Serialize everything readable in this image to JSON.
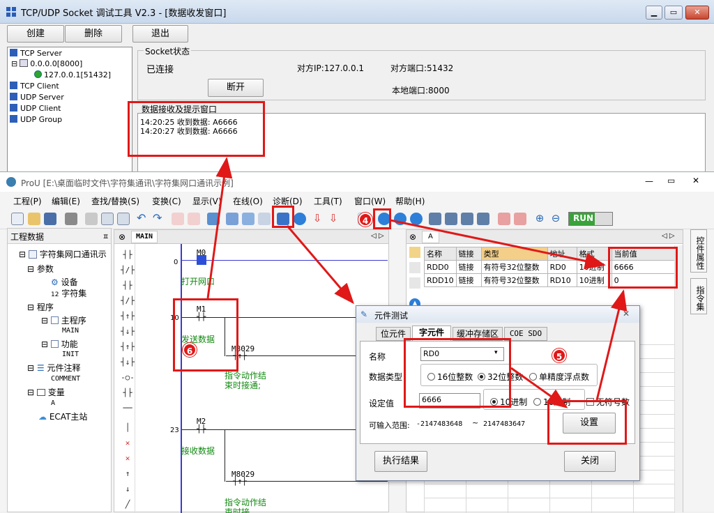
{
  "win1": {
    "title": "TCP/UDP Socket 调试工具 V2.3  - [数据收发窗口]",
    "buttons": {
      "create": "创建",
      "delete": "删除",
      "exit": "退出"
    },
    "tree": {
      "tcp_server": "TCP Server",
      "server_addr": "0.0.0.0[8000]",
      "client_conn": "127.0.0.1[51432]",
      "tcp_client": "TCP Client",
      "udp_server": "UDP Server",
      "udp_client": "UDP Client",
      "udp_group": "UDP Group"
    },
    "socket_status": {
      "group_title": "Socket状态",
      "state": "已连接",
      "peer_ip": "对方IP:127.0.0.1",
      "peer_port": "对方端口:51432",
      "local_port": "本地端口:8000",
      "disconnect": "断开"
    },
    "receive": {
      "group_title": "数据接收及提示窗口",
      "lines": [
        "14:20:25 收到数据: A6666",
        "14:20:27 收到数据: A6666"
      ]
    }
  },
  "win2": {
    "title": "ProU [E:\\桌面临时文件\\字符集通讯\\字符集网口通讯示例]",
    "menu": [
      "工程(P)",
      "编辑(E)",
      "查找/替换(S)",
      "变换(C)",
      "显示(V)",
      "在线(O)",
      "诊断(D)",
      "工具(T)",
      "窗口(W)",
      "帮助(H)"
    ],
    "run_label": "RUN",
    "project_panel": {
      "header": "工程数据",
      "root": "字符集网口通讯示",
      "params": "参数",
      "device": "设备",
      "charset": "字符集",
      "program": "程序",
      "main_program": "主程序",
      "main": "MAIN",
      "function": "功能",
      "init": "INIT",
      "element_comment": "元件注释",
      "comment": "COMMENT",
      "variable": "变量",
      "var_a": "A",
      "ecat": "ECAT主站"
    },
    "ladder": {
      "tab": "MAIN",
      "rungs": [
        {
          "num": "0",
          "contact": "M0",
          "comment": "打开网口"
        },
        {
          "num": "10",
          "contact": "M1",
          "comment": "发送数据"
        },
        {
          "num": "23",
          "contact": "M2",
          "comment": "接收数据"
        }
      ],
      "m8029_a": "M8029",
      "m8029_b": "M8029",
      "instr_comment_a": "指令动作结束时接通;",
      "instr_comment_b": "指令动作结束时接"
    },
    "monitor": {
      "tab": "A",
      "headers": [
        "名称",
        "链接",
        "类型",
        "地址",
        "格式",
        "当前值"
      ],
      "rows": [
        [
          "RDD0",
          "链接",
          "有符号32位整数",
          "RD0",
          "10进制",
          "6666"
        ],
        [
          "RDD10",
          "链接",
          "有符号32位整数",
          "RD10",
          "10进制",
          "0"
        ]
      ]
    },
    "side_tabs": [
      "控件属性",
      "指令集"
    ]
  },
  "dialog": {
    "title": "元件测试",
    "tabs": [
      "位元件",
      "字元件",
      "缓冲存储区",
      "COE SDO"
    ],
    "name_label": "名称",
    "name_value": "RD0",
    "type_label": "数据类型",
    "type_options": [
      "16位整数",
      "32位整数",
      "单精度浮点数"
    ],
    "set_label": "设定值",
    "set_value": "6666",
    "format_options": [
      "10进制",
      "16进制"
    ],
    "unsigned_label": "无符号数",
    "range_label": "可输入范围:",
    "range_min": "-2147483648",
    "range_sep": "~",
    "range_max": "2147483647",
    "set_button": "设置",
    "exec_result": "执行结果",
    "close_button": "关闭"
  },
  "badges": [
    "4",
    "5",
    "6"
  ],
  "colors": {
    "annotation_red": "#e01818",
    "comment_green": "#118a11",
    "run_green": "#3aa23a"
  }
}
